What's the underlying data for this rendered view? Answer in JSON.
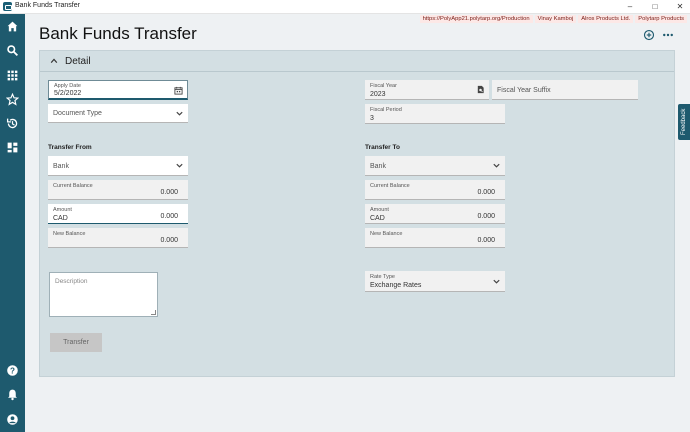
{
  "window": {
    "title": "Bank Funds Transfer"
  },
  "tags": [
    "https://PolyApp21.polytarp.org/Production",
    "Vinay Kamboj",
    "Alros Products Ltd.",
    "Polytarp Products"
  ],
  "page": {
    "title": "Bank Funds Transfer"
  },
  "feedback_label": "Feedback",
  "detail": {
    "title": "Detail",
    "apply_date": {
      "label": "Apply Date",
      "value": "5/2/2022"
    },
    "document_type": {
      "placeholder": "Document Type"
    },
    "fiscal_year": {
      "label": "Fiscal Year",
      "value": "2023"
    },
    "fiscal_year_suffix": {
      "placeholder": "Fiscal Year Suffix"
    },
    "fiscal_period": {
      "label": "Fiscal Period",
      "value": "3"
    },
    "transfer_from": {
      "heading": "Transfer From",
      "bank": "Bank",
      "current_balance": {
        "label": "Current Balance",
        "value": "0.000"
      },
      "amount": {
        "label": "Amount",
        "currency": "CAD",
        "value": "0.000"
      },
      "new_balance": {
        "label": "New Balance",
        "value": "0.000"
      }
    },
    "transfer_to": {
      "heading": "Transfer To",
      "bank": "Bank",
      "current_balance": {
        "label": "Current Balance",
        "value": "0.000"
      },
      "amount": {
        "label": "Amount",
        "currency": "CAD",
        "value": "0.000"
      },
      "new_balance": {
        "label": "New Balance",
        "value": "0.000"
      }
    },
    "description": {
      "placeholder": "Description"
    },
    "rate_type": {
      "label": "Rate Type",
      "value": "Exchange Rates"
    },
    "transfer_button": "Transfer"
  }
}
